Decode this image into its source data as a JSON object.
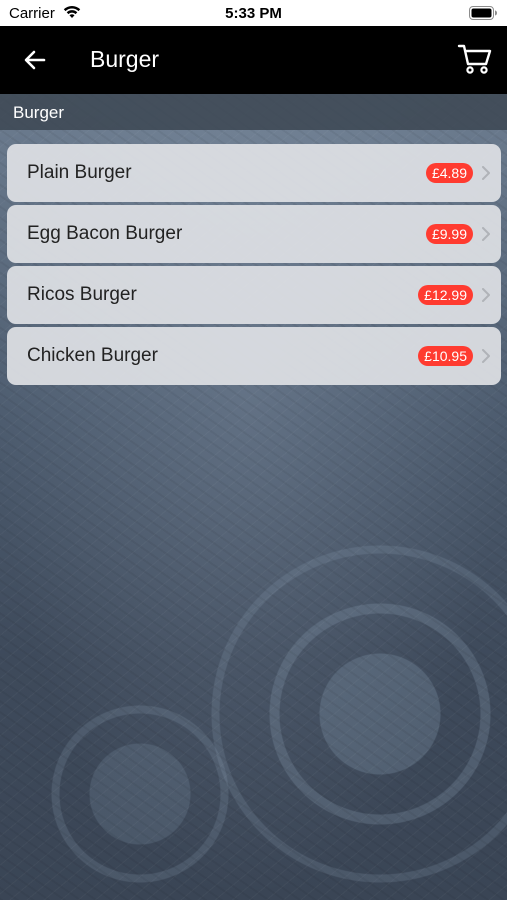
{
  "status_bar": {
    "carrier": "Carrier",
    "time": "5:33 PM",
    "wifi_icon": "wifi-icon",
    "battery_icon": "battery-icon"
  },
  "nav": {
    "title": "Burger",
    "back_icon": "arrow-left-icon",
    "cart_icon": "cart-icon"
  },
  "section": {
    "title": "Burger"
  },
  "items": [
    {
      "name": "Plain Burger",
      "price": "£4.89"
    },
    {
      "name": "Egg Bacon Burger",
      "price": "£9.99"
    },
    {
      "name": "Ricos Burger",
      "price": "£12.99"
    },
    {
      "name": "Chicken Burger",
      "price": "£10.95"
    }
  ],
  "colors": {
    "nav_bg": "#000000",
    "price_badge": "#ff3b30",
    "row_bg": "#dee0e4"
  }
}
